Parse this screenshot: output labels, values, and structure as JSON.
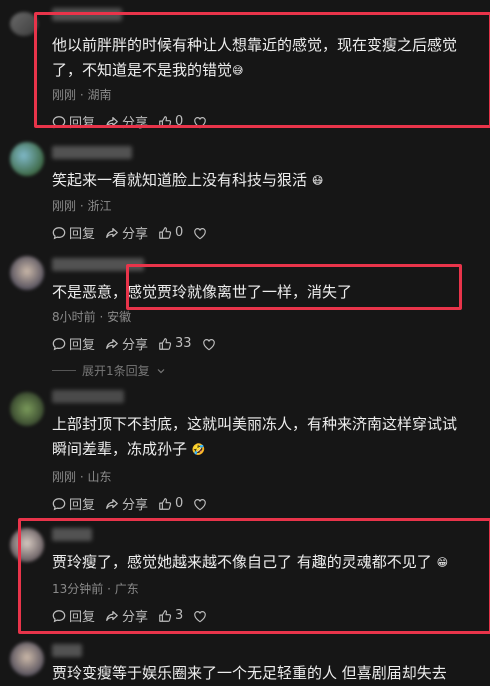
{
  "comments": [
    {
      "text": "他以前胖胖的时候有种让人想靠近的感觉，现在变瘦之后感觉\n了，不知道是不是我的错觉",
      "emoji": "😅",
      "time": "刚刚",
      "location": "湖南",
      "reply_label": "回复",
      "share_label": "分享",
      "likes": "0"
    },
    {
      "text": "笑起来一看就知道脸上没有科技与狠活",
      "emoji": "😷",
      "time": "刚刚",
      "location": "浙江",
      "reply_label": "回复",
      "share_label": "分享",
      "likes": "0"
    },
    {
      "text": "不是恶意，感觉贾玲就像离世了一样，消失了",
      "emoji": "",
      "time": "8小时前",
      "location": "安徽",
      "reply_label": "回复",
      "share_label": "分享",
      "likes": "33",
      "expand_label": "展开1条回复"
    },
    {
      "text": "上部封顶下不封底，这就叫美丽冻人，有种来济南这样穿试试\n瞬间差辈，冻成孙子",
      "emoji": "🤣",
      "time": "刚刚",
      "location": "山东",
      "reply_label": "回复",
      "share_label": "分享",
      "likes": "0"
    },
    {
      "text": "贾玲瘦了，感觉她越来越不像自己了 有趣的灵魂都不见了",
      "emoji": "😁",
      "time": "13分钟前",
      "location": "广东",
      "reply_label": "回复",
      "share_label": "分享",
      "likes": "3"
    },
    {
      "text": "贾玲变瘦等于娱乐圈来了一个无足轻重的人 但喜剧届却失去",
      "emoji": "",
      "time": "",
      "location": "",
      "reply_label": "",
      "share_label": "",
      "likes": ""
    }
  ],
  "colors": {
    "highlight_border": "#e8344a",
    "background": "#161616",
    "meta_text": "#8a8a8a"
  },
  "icons": [
    "comment-icon",
    "share-icon",
    "like-icon",
    "dislike-icon",
    "chevron-down-icon"
  ]
}
